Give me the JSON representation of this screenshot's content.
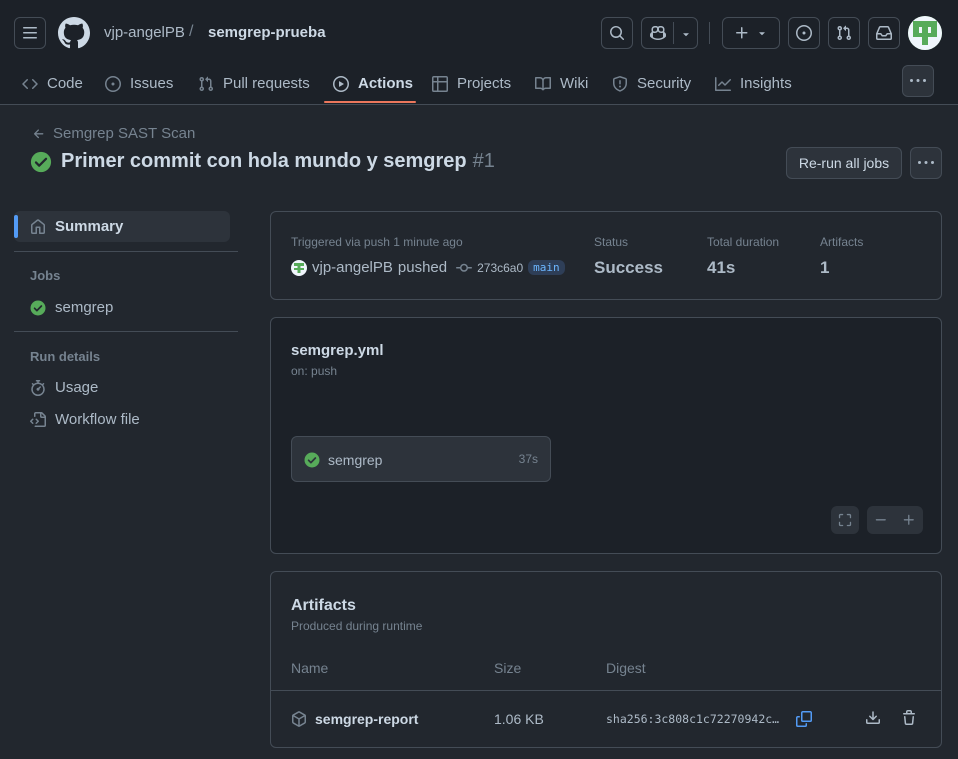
{
  "header": {
    "owner": "vjp-angelPB",
    "separator": "/",
    "repo": "semgrep-prueba"
  },
  "nav": {
    "tabs": [
      {
        "label": "Code",
        "icon": "code-icon"
      },
      {
        "label": "Issues",
        "icon": "issue-icon"
      },
      {
        "label": "Pull requests",
        "icon": "pull-request-icon"
      },
      {
        "label": "Actions",
        "icon": "play-icon",
        "active": true
      },
      {
        "label": "Projects",
        "icon": "table-icon"
      },
      {
        "label": "Wiki",
        "icon": "book-icon"
      },
      {
        "label": "Security",
        "icon": "shield-icon"
      },
      {
        "label": "Insights",
        "icon": "graph-icon"
      }
    ]
  },
  "run": {
    "back_label": "Semgrep SAST Scan",
    "title": "Primer commit con hola mundo y semgrep",
    "number": "#1",
    "rerun_label": "Re-run all jobs"
  },
  "sidebar": {
    "summary_label": "Summary",
    "jobs_heading": "Jobs",
    "job_label": "semgrep",
    "run_details_heading": "Run details",
    "usage_label": "Usage",
    "workflow_file_label": "Workflow file"
  },
  "summary": {
    "triggered_label": "Triggered via push 1 minute ago",
    "actor": "vjp-angelPB",
    "pushed_text": "pushed",
    "commit_sha": "273c6a0",
    "branch": "main",
    "status_label": "Status",
    "status_value": "Success",
    "duration_label": "Total duration",
    "duration_value": "41s",
    "artifacts_label": "Artifacts",
    "artifacts_value": "1"
  },
  "workflow": {
    "file": "semgrep.yml",
    "trigger": "on: push",
    "job_name": "semgrep",
    "job_duration": "37s"
  },
  "artifacts": {
    "title": "Artifacts",
    "subtitle": "Produced during runtime",
    "columns": {
      "name": "Name",
      "size": "Size",
      "digest": "Digest"
    },
    "rows": [
      {
        "name": "semgrep-report",
        "size": "1.06 KB",
        "digest": "sha256:3c808c1c72270942c…"
      }
    ]
  },
  "colors": {
    "background": "#22272e",
    "header": "#1c2128",
    "success": "#57ab5a",
    "accent": "#539bf5",
    "active_tab": "#ec775c"
  }
}
